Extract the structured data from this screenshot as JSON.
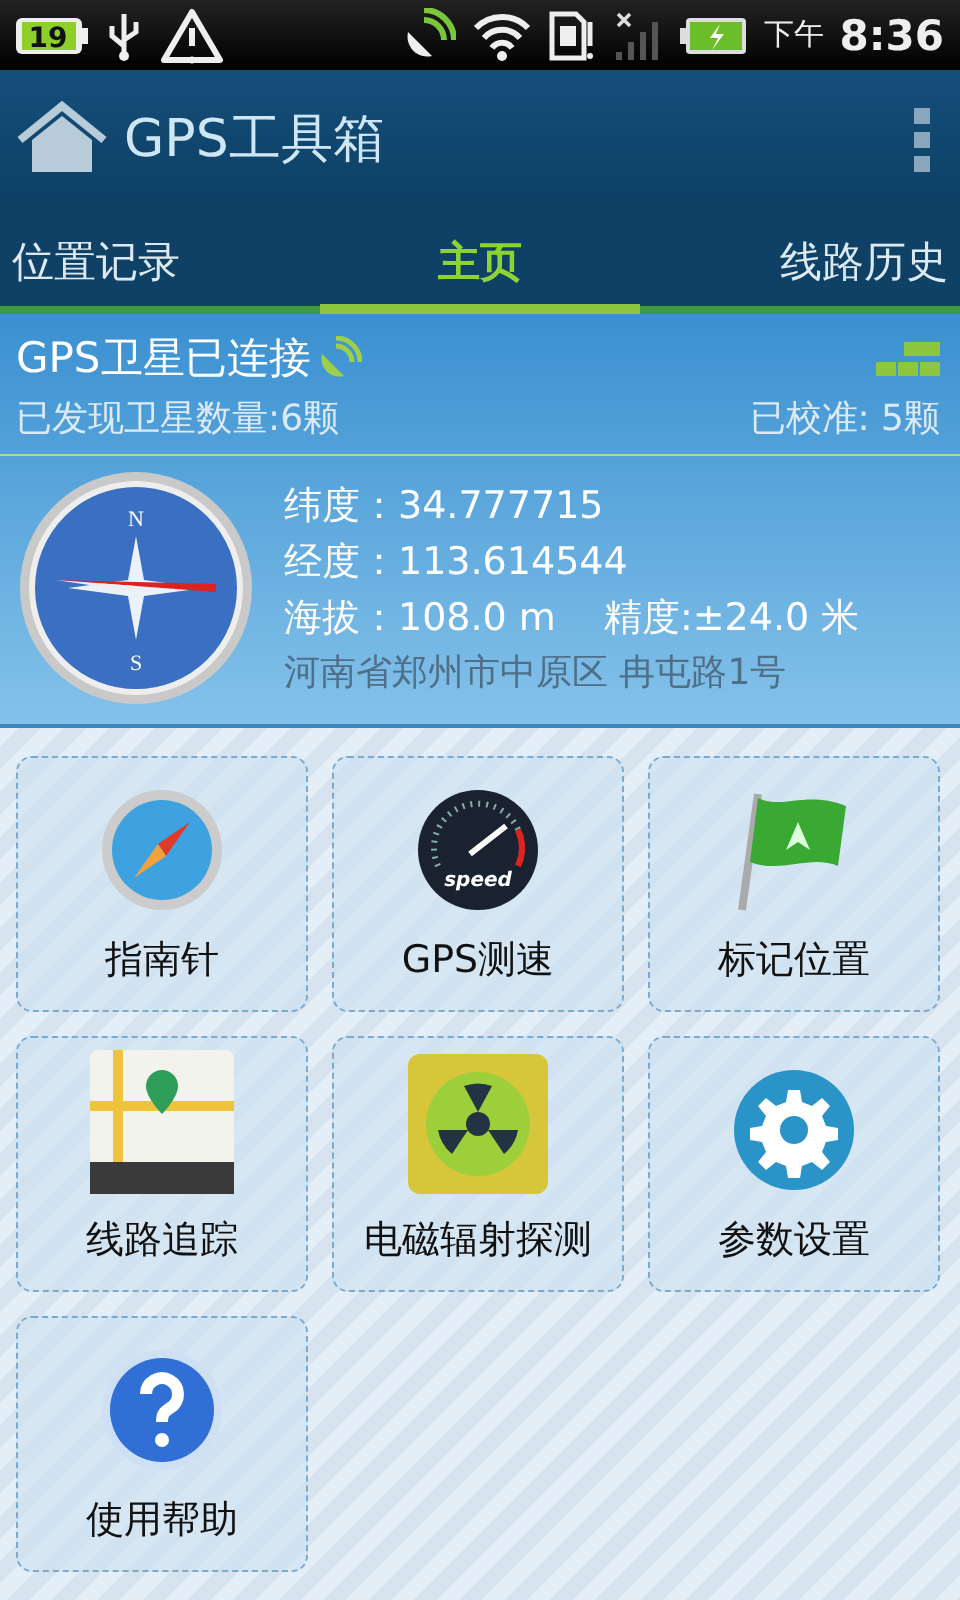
{
  "status_bar": {
    "battery": "19",
    "time_period": "下午",
    "time": "8:36"
  },
  "app_bar": {
    "title": "GPS工具箱"
  },
  "tabs": [
    {
      "label": "位置记录",
      "selected": false
    },
    {
      "label": "主页",
      "selected": true
    },
    {
      "label": "线路历史",
      "selected": false
    }
  ],
  "gps_panel": {
    "status": "GPS卫星已连接",
    "found": "已发现卫星数量:6颗",
    "calibrated": "已校准: 5颗",
    "latitude": "纬度：34.777715",
    "longitude": "经度：113.614544",
    "altitude": "海拔：108.0 m",
    "accuracy": "精度:±24.0 米",
    "address": "河南省郑州市中原区 冉屯路1号",
    "compass_north": "N",
    "compass_south": "S"
  },
  "tools": [
    {
      "label": "指南针",
      "kind": "compass"
    },
    {
      "label": "GPS测速",
      "kind": "speedometer",
      "icon_text": "speed"
    },
    {
      "label": "标记位置",
      "kind": "flag"
    },
    {
      "label": "线路追踪",
      "kind": "map"
    },
    {
      "label": "电磁辐射探测",
      "kind": "radiation"
    },
    {
      "label": "参数设置",
      "kind": "gear"
    },
    {
      "label": "使用帮助",
      "kind": "help"
    }
  ]
}
